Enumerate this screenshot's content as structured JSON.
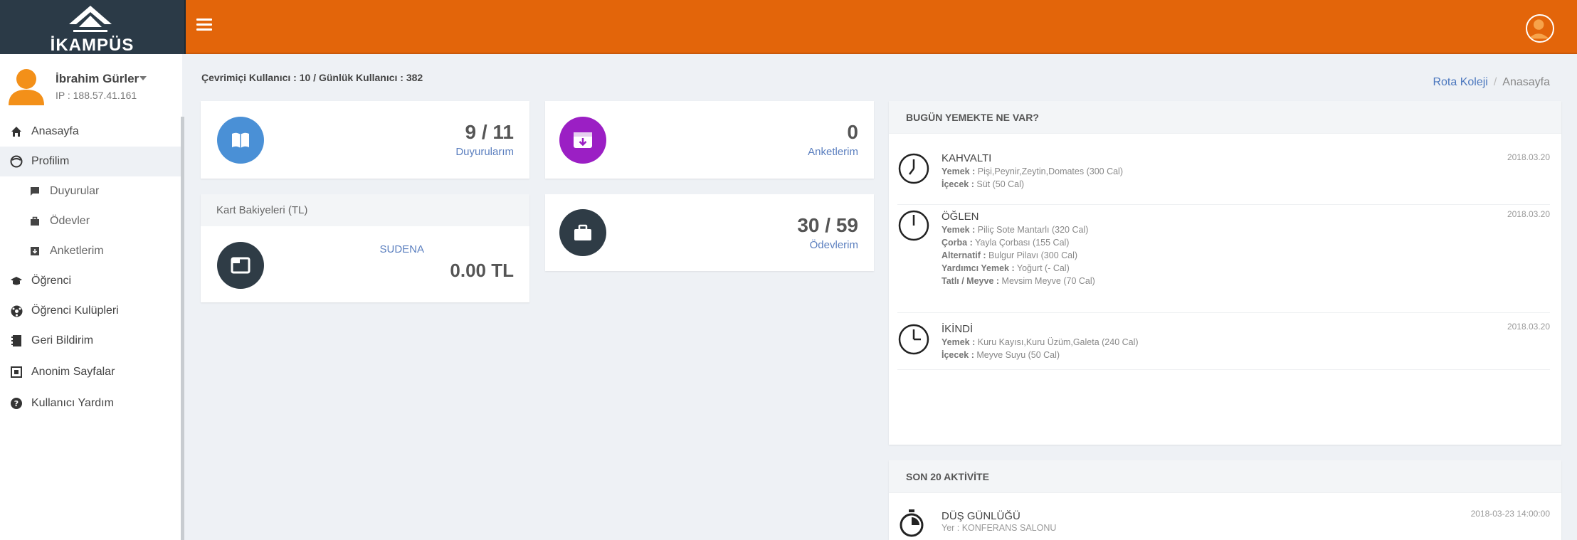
{
  "brand": {
    "name": "İKAMPÜS"
  },
  "user": {
    "name": "İbrahim Gürler",
    "ip": "IP : 188.57.41.161"
  },
  "nav": [
    {
      "label": "Anasayfa",
      "icon": "home-icon"
    },
    {
      "label": "Profilim",
      "icon": "face-icon"
    },
    {
      "label": "Duyurular",
      "icon": "chat-icon"
    },
    {
      "label": "Ödevler",
      "icon": "briefcase-icon"
    },
    {
      "label": "Anketlerim",
      "icon": "archive-icon"
    },
    {
      "label": "Öğrenci",
      "icon": "graduation-cap-icon"
    },
    {
      "label": "Öğrenci Kulüpleri",
      "icon": "ball-icon"
    },
    {
      "label": "Geri Bildirim",
      "icon": "notebook-icon"
    },
    {
      "label": "Anonim Sayfalar",
      "icon": "mask-icon"
    },
    {
      "label": "Kullanıcı Yardım",
      "icon": "help-icon"
    }
  ],
  "status": {
    "online_line": "Çevrimiçi Kullanıcı : 10 / Günlük Kullanıcı : 382"
  },
  "breadcrumb": {
    "root": "Rota Koleji",
    "sep": "/",
    "current": "Anasayfa"
  },
  "stats": {
    "duyurular": {
      "value": "9 / 11",
      "label": "Duyurularım"
    },
    "anketler": {
      "value": "0",
      "label": "Anketlerim"
    },
    "odevler": {
      "value": "30 / 59",
      "label": "Ödevlerim"
    }
  },
  "kart": {
    "title": "Kart Bakiyeleri (TL)",
    "name": "SUDENA",
    "amount": "0.00 TL"
  },
  "menu": {
    "title": "BUGÜN YEMEKTE NE VAR?",
    "meals": [
      {
        "title": "KAHVALTI",
        "date": "2018.03.20",
        "lines": [
          {
            "k": "Yemek :",
            "v": "Pişi,Peynir,Zeytin,Domates (300 Cal)"
          },
          {
            "k": "İçecek :",
            "v": "Süt (50 Cal)"
          }
        ]
      },
      {
        "title": "ÖĞLEN",
        "date": "2018.03.20",
        "lines": [
          {
            "k": "Yemek :",
            "v": "Piliç Sote Mantarlı (320 Cal)"
          },
          {
            "k": "Çorba :",
            "v": "Yayla Çorbası (155 Cal)"
          },
          {
            "k": "Alternatif :",
            "v": "Bulgur Pilavı (300 Cal)"
          },
          {
            "k": "Yardımcı Yemek :",
            "v": "Yoğurt (- Cal)"
          },
          {
            "k": "Tatlı / Meyve :",
            "v": "Mevsim Meyve (70 Cal)"
          }
        ]
      },
      {
        "title": "İKİNDİ",
        "date": "2018.03.20",
        "lines": [
          {
            "k": "Yemek :",
            "v": "Kuru Kayısı,Kuru Üzüm,Galeta (240 Cal)"
          },
          {
            "k": "İçecek :",
            "v": "Meyve Suyu (50 Cal)"
          }
        ]
      }
    ]
  },
  "activity": {
    "title": "SON 20 AKTİVİTE",
    "items": [
      {
        "title": "DÜŞ GÜNLÜĞÜ",
        "place": "Yer : KONFERANS SALONU",
        "date": "2018-03-23 14:00:00"
      }
    ]
  },
  "colors": {
    "topbar": "#e3650a",
    "brand_bg": "#2b3a47",
    "blue": "#4a90d6",
    "purple": "#9b1fc4",
    "dark": "#2f3c46"
  }
}
